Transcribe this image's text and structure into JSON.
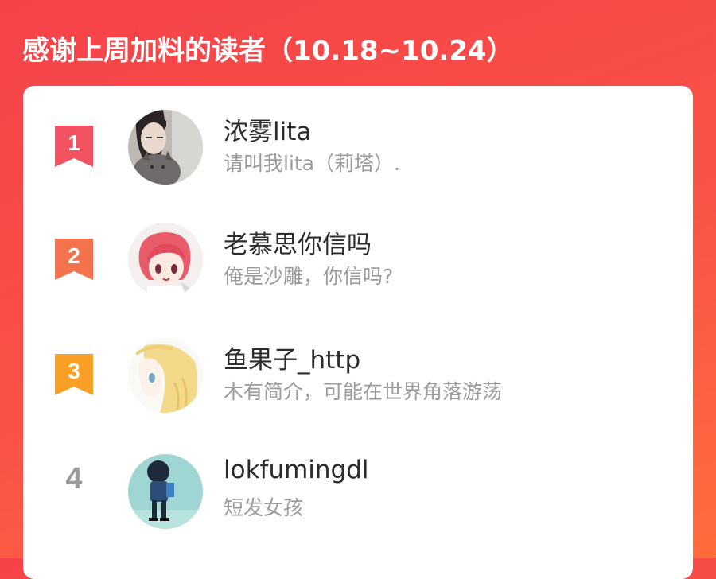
{
  "header": {
    "title": "感谢上周加料的读者（10.18~10.24）"
  },
  "colors": {
    "background_start": "#f7424a",
    "background_end": "#ff6c3c",
    "rank1": "#f2525f",
    "rank2": "#f4734c",
    "rank3": "#f7a025",
    "rank_plain": "#9a9a9a"
  },
  "readers": [
    {
      "rank": "1",
      "name": "浓雾lita",
      "bio": "请叫我lita（莉塔）.",
      "avatar_icon": "girl-with-cat-avatar"
    },
    {
      "rank": "2",
      "name": "老慕思你信吗",
      "bio": "俺是沙雕，你信吗?",
      "avatar_icon": "pink-hair-anime-girl-avatar"
    },
    {
      "rank": "3",
      "name": "鱼果子_http",
      "bio": "木有简介，可能在世界角落游荡",
      "avatar_icon": "blonde-anime-girl-avatar"
    },
    {
      "rank": "4",
      "name": "lokfumingdl",
      "bio": "短发女孩",
      "avatar_icon": "short-hair-girl-avatar"
    }
  ]
}
